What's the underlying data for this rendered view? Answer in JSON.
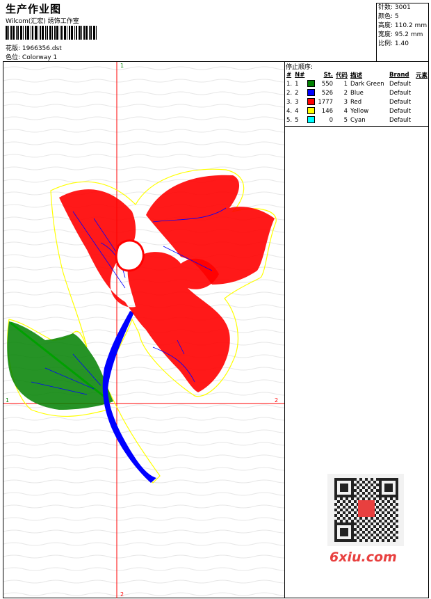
{
  "header": {
    "title": "生产作业图",
    "subtitle": "Wilcom(汇宏) 绣饰工作室",
    "file_label": "花版:",
    "file_value": "1966356.dst",
    "colorway_label": "色位:",
    "colorway_value": "Colorway 1"
  },
  "stats": [
    {
      "label": "针数:",
      "value": "3001"
    },
    {
      "label": "颜色:",
      "value": "5"
    },
    {
      "label": "高度:",
      "value": "110.2 mm"
    },
    {
      "label": "宽度:",
      "value": "95.2 mm"
    },
    {
      "label": "比例:",
      "value": "1.40"
    }
  ],
  "stop_sequence": {
    "title": "停止顺序:",
    "columns": [
      "#",
      "N#",
      "St.",
      "代码",
      "描述",
      "Brand",
      "元素"
    ],
    "rows": [
      {
        "idx": "1.",
        "n": "1",
        "color": "#008000",
        "stitches": "550",
        "code": "1",
        "desc": "Dark Green",
        "brand": "Default",
        "element": ""
      },
      {
        "idx": "2.",
        "n": "2",
        "color": "#0000ff",
        "stitches": "526",
        "code": "2",
        "desc": "Blue",
        "brand": "Default",
        "element": ""
      },
      {
        "idx": "3.",
        "n": "3",
        "color": "#ff0000",
        "stitches": "1777",
        "code": "3",
        "desc": "Red",
        "brand": "Default",
        "element": ""
      },
      {
        "idx": "4.",
        "n": "4",
        "color": "#ffff00",
        "stitches": "146",
        "code": "4",
        "desc": "Yellow",
        "brand": "Default",
        "element": ""
      },
      {
        "idx": "5.",
        "n": "5",
        "color": "#00ffff",
        "stitches": "0",
        "code": "5",
        "desc": "Cyan",
        "brand": "Default",
        "element": ""
      }
    ]
  },
  "axes": {
    "v_top": "1",
    "v_bottom": "2",
    "h_left": "1",
    "h_right": "2"
  },
  "colors": {
    "guide": "#ff0000",
    "red_thread": "#ff0000",
    "green_thread": "#008000",
    "blue_thread": "#0000ff",
    "outline": "#ffff00"
  },
  "watermark": {
    "brand": "6xiu.com"
  }
}
